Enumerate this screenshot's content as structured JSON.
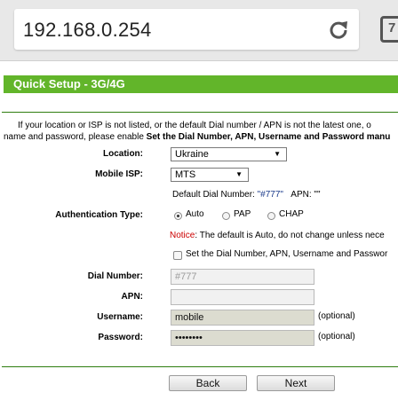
{
  "browser": {
    "url": "192.168.0.254",
    "tab_count": "7"
  },
  "page": {
    "title": "Quick Setup - 3G/4G",
    "intro_line1": "If your location or ISP is not listed, or the default Dial number / APN is not the latest one, o",
    "intro_line2_plain": "name and password, please enable ",
    "intro_line2_bold": "Set the Dial Number, APN, Username and Password manu",
    "location": {
      "label": "Location:",
      "value": "Ukraine"
    },
    "mobile_isp": {
      "label": "Mobile ISP:",
      "value": "MTS"
    },
    "default_dial": {
      "prefix": "Default Dial Number: ",
      "number": "\"#777\"",
      "apn_label": "APN: ",
      "apn_value": "\"\""
    },
    "auth": {
      "label": "Authentication Type:",
      "options": [
        "Auto",
        "PAP",
        "CHAP"
      ],
      "selected": "Auto"
    },
    "notice": {
      "label": "Notice",
      "text": ": The default is Auto, do not change unless nece"
    },
    "manual_checkbox_label": "Set the Dial Number, APN, Username and Passwor",
    "dial_number": {
      "label": "Dial Number:",
      "placeholder": "#777"
    },
    "apn": {
      "label": "APN:",
      "value": ""
    },
    "username": {
      "label": "Username:",
      "value": "mobile",
      "hint": "(optional)"
    },
    "password": {
      "label": "Password:",
      "value": "••••••••",
      "hint": "(optional)"
    },
    "buttons": {
      "back": "Back",
      "next": "Next"
    },
    "colors": {
      "header_green": "#62b52a",
      "rule_green": "#2f7d10",
      "notice_red": "#cc0000",
      "value_blue": "#1a3a8a"
    }
  }
}
